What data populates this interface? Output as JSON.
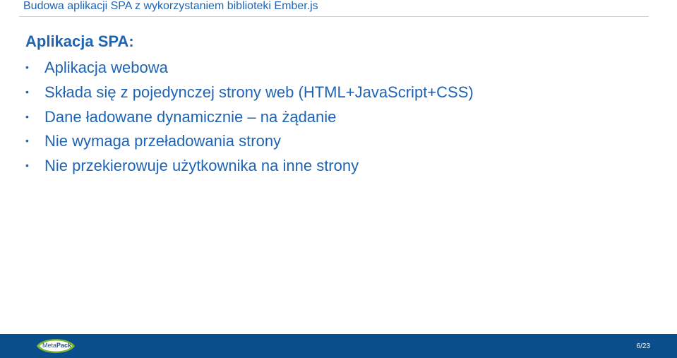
{
  "header": {
    "title": "Budowa aplikacji SPA z wykorzystaniem biblioteki Ember.js"
  },
  "content": {
    "heading": "Aplikacja SPA:",
    "bullet_symbol": "•",
    "bullets": [
      "Aplikacja webowa",
      "Składa się z pojedynczej strony web (HTML+JavaScript+CSS)",
      "Dane ładowane dynamicznie – na żądanie",
      "Nie wymaga przeładowania strony",
      "Nie przekierowuje użytkownika na inne strony"
    ]
  },
  "footer": {
    "logo_text_light": "Meta",
    "logo_text_bold": "Pack",
    "page_number": "6/23",
    "bar_color": "#0a4f8c"
  },
  "colors": {
    "text_primary": "#1f64b4",
    "header_rule": "#c6d9a0",
    "background": "#ffffff"
  }
}
